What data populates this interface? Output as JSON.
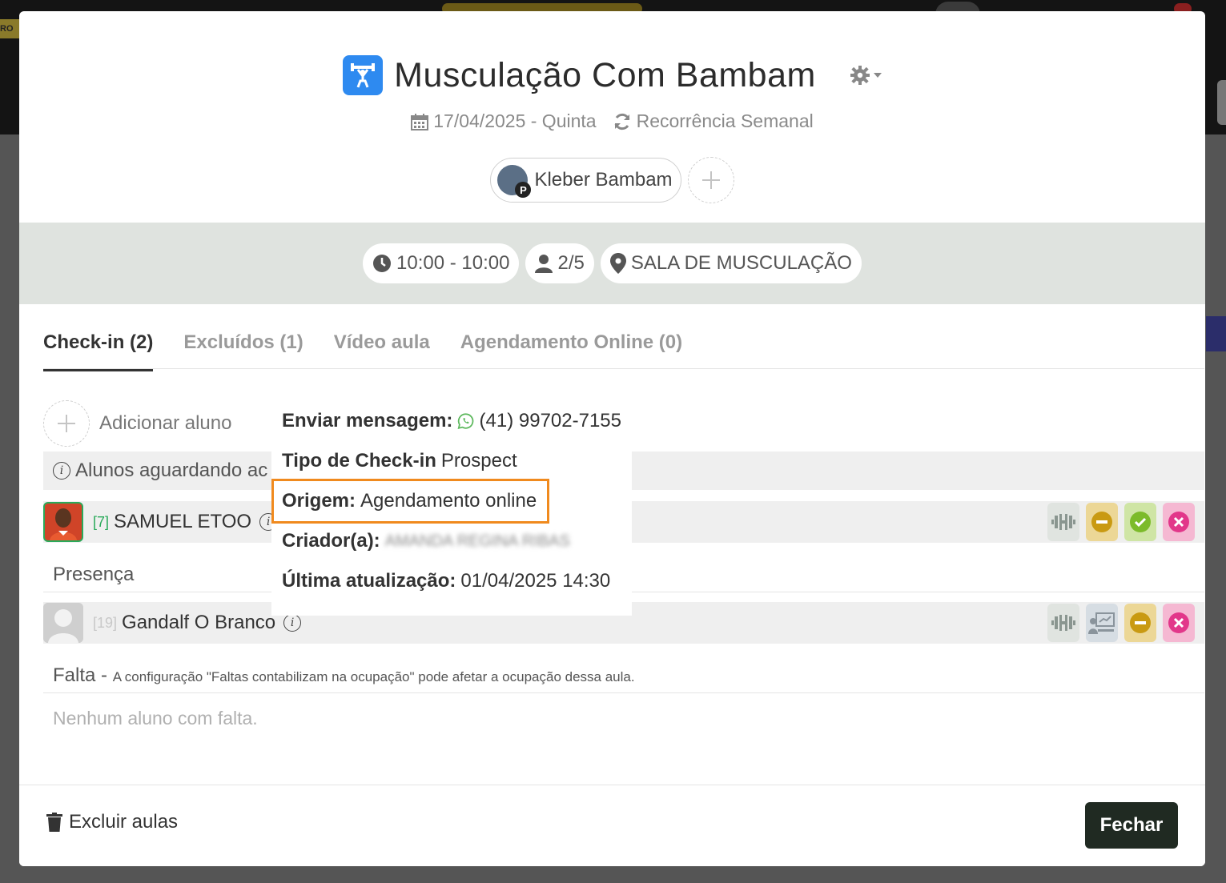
{
  "background": {
    "left_tag": "RO"
  },
  "header": {
    "title": "Musculação Com Bambam",
    "date": "17/04/2025 - Quinta",
    "recurrence": "Recorrência Semanal",
    "professional": "Kleber Bambam",
    "professional_badge": "P"
  },
  "info": {
    "time": "10:00 - 10:00",
    "capacity": "2/5",
    "room": "SALA DE MUSCULAÇÃO"
  },
  "tabs": [
    {
      "label": "Check-in (2)",
      "active": true
    },
    {
      "label": "Excluídos (1)",
      "active": false
    },
    {
      "label": "Vídeo aula",
      "active": false
    },
    {
      "label": "Agendamento Online (0)",
      "active": false
    }
  ],
  "checkin": {
    "add_student": "Adicionar aluno",
    "waiting_text": "Alunos aguardando ac",
    "students_waiting": [
      {
        "number": "[7]",
        "name": "SAMUEL ETOO"
      }
    ],
    "presence_label": "Presença",
    "students_present": [
      {
        "number": "[19]",
        "name": "Gandalf O Branco"
      }
    ],
    "absence_label": "Falta -",
    "absence_note": "A configuração \"Faltas contabilizam na ocupação\" pode afetar a ocupação dessa aula.",
    "absence_empty": "Nenhum aluno com falta."
  },
  "popover": {
    "send_message_label": "Enviar mensagem:",
    "phone": "(41) 99702-7155",
    "checkin_type_label": "Tipo de Check-in",
    "checkin_type_value": "Prospect",
    "origin_label": "Origem:",
    "origin_value": "Agendamento online",
    "creator_label": "Criador(a):",
    "creator_value": "AMANDA REGINA RIBAS",
    "updated_label": "Última atualização:",
    "updated_value": "01/04/2025 14:30"
  },
  "footer": {
    "delete_label": "Excluir aulas",
    "close_label": "Fechar"
  },
  "colors": {
    "highlight": "#f08a1e",
    "brand_icon": "#2e8af0",
    "close_button": "#202a22"
  }
}
